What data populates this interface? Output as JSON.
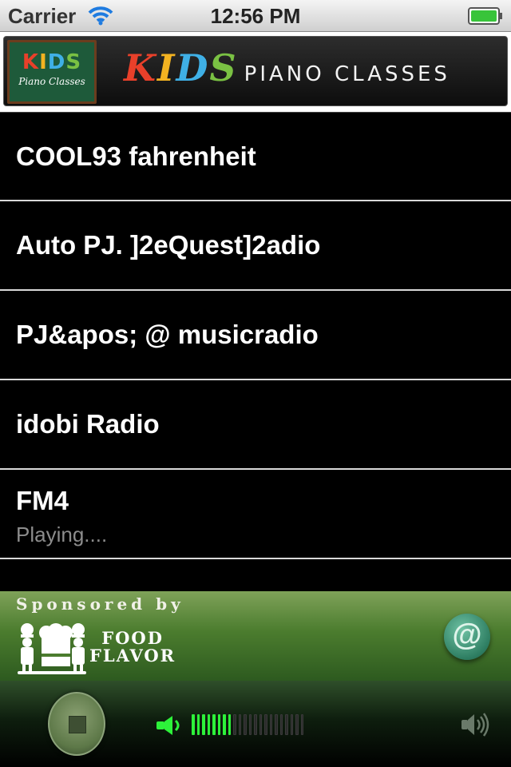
{
  "status_bar": {
    "carrier": "Carrier",
    "time": "12:56 PM"
  },
  "banner": {
    "logo_title": "KIDS",
    "logo_subtitle": "Piano Classes",
    "title_main": "KIDS",
    "title_rest": "PIANO CLASSES"
  },
  "stations": [
    {
      "name": "COOL93 fahrenheit",
      "status": ""
    },
    {
      "name": "Auto PJ. ]2eQuest]2adio",
      "status": ""
    },
    {
      "name": "PJ&apos; @ musicradio",
      "status": ""
    },
    {
      "name": "idobi Radio",
      "status": ""
    },
    {
      "name": "FM4",
      "status": "Playing...."
    }
  ],
  "sponsor": {
    "label": "Sponsored by",
    "brand_line1": "FOOD",
    "brand_line2": "FLAVOR",
    "contact_icon": "at-icon",
    "contact_symbol": "@"
  },
  "player": {
    "stop_icon": "stop-icon",
    "volume_level": 0.36,
    "volume_segments": 22,
    "volume_low_icon": "speaker-low-icon",
    "volume_high_icon": "speaker-high-icon"
  },
  "colors": {
    "meter_on": "#2df23a",
    "sponsor_bg": "#4b7c2e"
  }
}
